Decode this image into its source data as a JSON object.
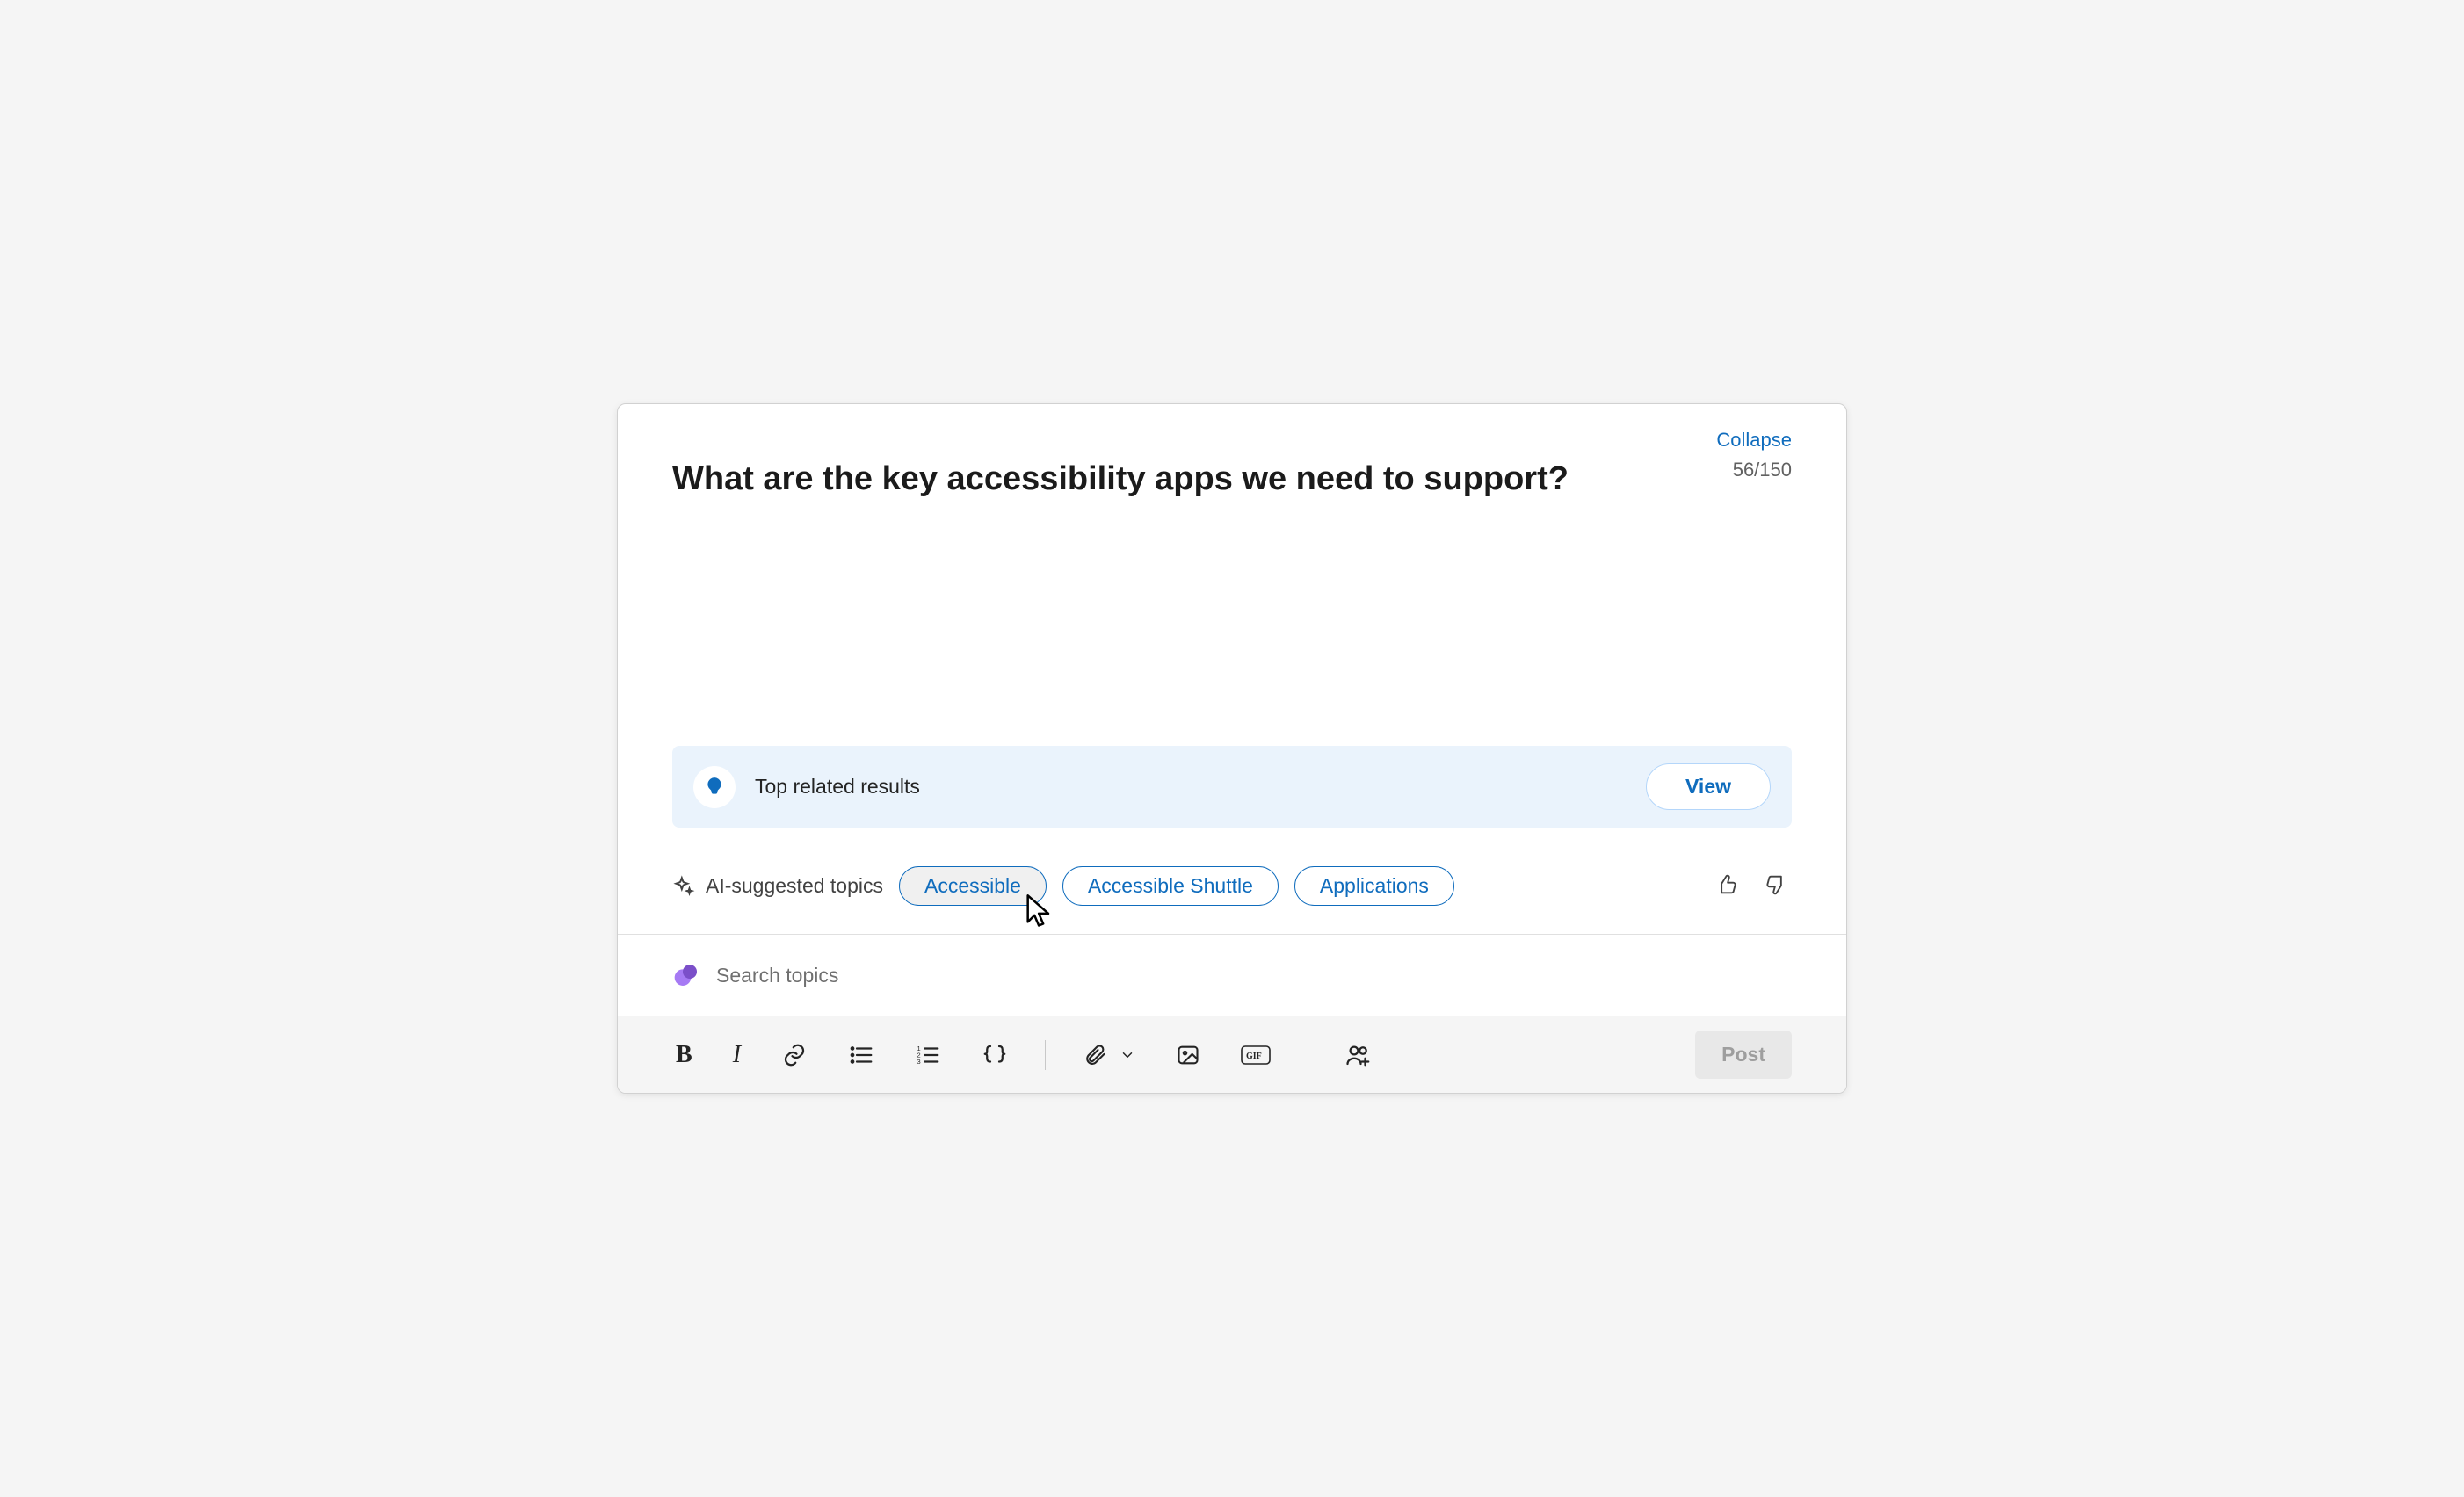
{
  "header": {
    "collapse": "Collapse",
    "title": "What are the key accessibility apps we need to support?",
    "char_count": "56/150"
  },
  "related": {
    "label": "Top related results",
    "view_button": "View"
  },
  "ai_topics": {
    "label": "AI-suggested topics",
    "pills": [
      "Accessible",
      "Accessible Shuttle",
      "Applications"
    ]
  },
  "search": {
    "placeholder": "Search topics"
  },
  "toolbar": {
    "post_label": "Post"
  }
}
